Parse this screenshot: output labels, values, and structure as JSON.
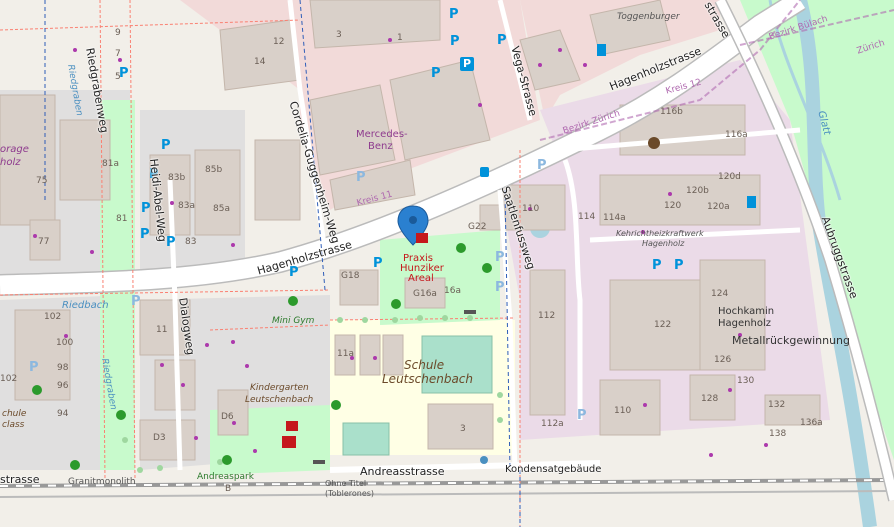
{
  "map": {
    "marker_label": "Praxis Hunziker Areal",
    "marker_line1": "Praxis",
    "marker_line2": "Hunziker",
    "marker_line3": "Areal",
    "colors": {
      "background": "#f2efe9",
      "residential": "#e0dfdf",
      "commercial": "#f2dad9",
      "industrial": "#ebdbe8",
      "school": "#ffffe5",
      "park": "#c8facc",
      "pitch": "#aae0cb",
      "water": "#aad3df",
      "building": "#d9d0c9",
      "road_major": "#ffffff",
      "railway": "#999999",
      "parking_icon": "#0092da",
      "marker": "#2a80d0"
    },
    "streets": {
      "hagenholz_main": "Hagenholzstrasse",
      "hagenholz_east": "Hagenholzstrasse",
      "cordelia": "Cordelia-Guggenheim-Weg",
      "riedgraben": "Riedgrabenweg",
      "heidi": "Heidi-Abel-Weg",
      "dialog": "Dialogweg",
      "vega": "Vega-Strasse",
      "saatlen": "Saatlenfussweg",
      "aubrugg": "Aubruggstrasse",
      "andreas": "Andreasstrasse",
      "kondensat": "Kondensatgebäude",
      "strasse_left": "strasse",
      "strasse_top": "strasse",
      "ried_rot": "Riedgraben",
      "ried_rot2": "Riedgraben",
      "riedbach": "Riedbach"
    },
    "places": {
      "mercedes1": "Mercedes-",
      "mercedes2": "Benz",
      "kreis11": "Kreis 11",
      "kreis12": "Kreis 12",
      "bezirk_zurich": "Bezirk Zürich",
      "bezirk_bulach": "Bezirk Bülach",
      "zurich": "Zürich",
      "glatt": "Glatt",
      "toggenburger": "Toggenburger",
      "kehricht1": "Kehrichtheizkraftwerk",
      "kehricht2": "Hagenholz",
      "hochkamin1": "Hochkamin",
      "hochkamin2": "Hagenholz",
      "metall": "Metallrückgewinnung",
      "schule1": "Schule",
      "schule2": "Leutschenbach",
      "kiga1": "Kindergarten",
      "kiga2": "Leutschenbach",
      "minigym": "Mini Gym",
      "andreaspark": "Andreaspark",
      "granitmonolith": "Granitmonolith",
      "ohne1": "Ohne Titel",
      "ohne2": "(Toblerones)",
      "storage1": "orage",
      "storage2": "holz",
      "schule_left1": "chule",
      "schule_left2": "class"
    },
    "house_numbers": {
      "n3": "3",
      "n1": "1",
      "n12": "12",
      "n14": "14",
      "n9": "9",
      "n7": "7",
      "n5": "5",
      "n81a": "81a",
      "n83b": "83b",
      "n85b": "85b",
      "n83a": "83a",
      "n85a": "85a",
      "n81": "81",
      "n83": "83",
      "n75": "75",
      "n77": "77",
      "n116b": "116b",
      "n116a": "116a",
      "n120d": "120d",
      "n120b": "120b",
      "n120": "120",
      "n120a": "120a",
      "n110": "110",
      "n114": "114",
      "n114a": "114a",
      "nG22": "G22",
      "nG18": "G18",
      "nG16a": "G16a",
      "n16a": "16a",
      "n112": "112",
      "n122": "122",
      "n124": "124",
      "n126": "126",
      "n128": "128",
      "n130": "130",
      "n132": "132",
      "n136a": "136a",
      "n138": "138",
      "n110b": "110",
      "n112a": "112a",
      "n11": "11",
      "n11a": "11a",
      "n102": "102",
      "n100": "100",
      "n98": "98",
      "n96": "96",
      "n94": "94",
      "n102l": "102",
      "nD6": "D6",
      "nD3": "D3",
      "nB": "B",
      "n3s": "3"
    },
    "parking": {
      "label": "P"
    }
  }
}
